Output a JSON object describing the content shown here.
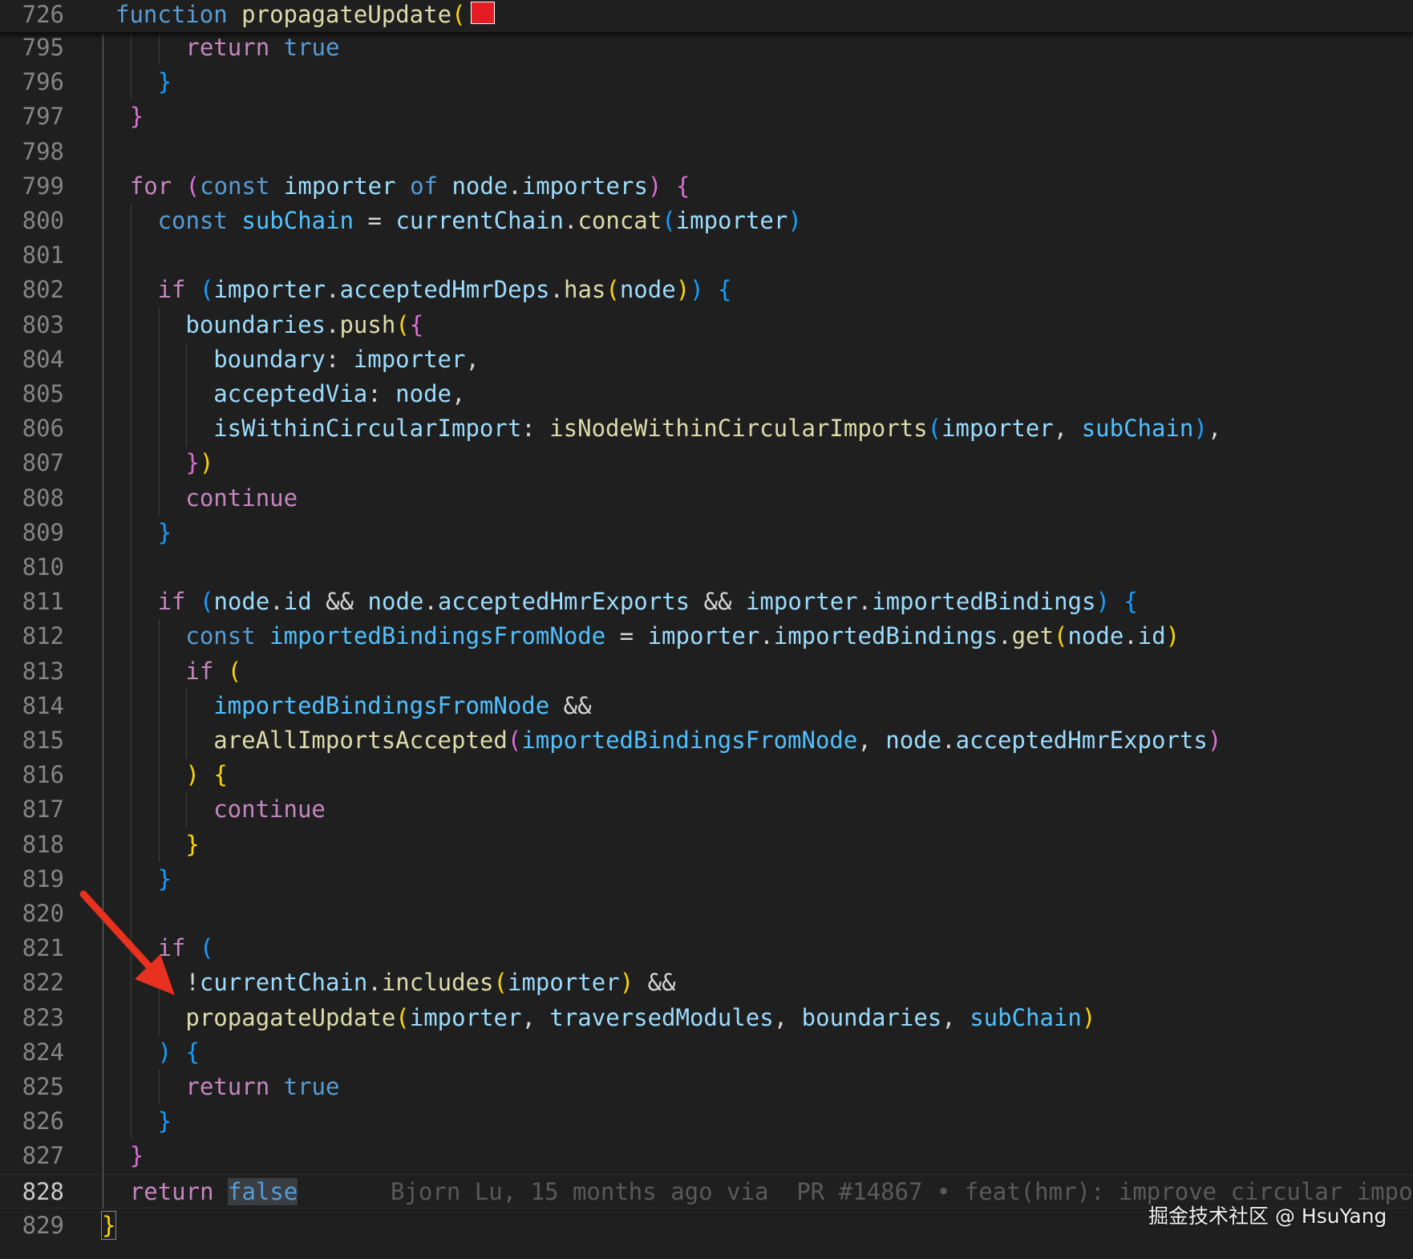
{
  "sticky_scroll": {
    "line_number": "726",
    "segments": [
      {
        "t": "function",
        "c": "kw"
      },
      {
        "t": " ",
        "c": "plain"
      },
      {
        "t": "propagateUpdate",
        "c": "fn"
      },
      {
        "t": "(",
        "c": "b1"
      }
    ]
  },
  "lines": [
    {
      "n": "795",
      "i": 3,
      "segs": [
        {
          "t": "return",
          "c": "ctl"
        },
        {
          "t": " ",
          "c": "plain"
        },
        {
          "t": "true",
          "c": "kw"
        }
      ]
    },
    {
      "n": "796",
      "i": 2,
      "segs": [
        {
          "t": "}",
          "c": "b3"
        }
      ]
    },
    {
      "n": "797",
      "i": 1,
      "segs": [
        {
          "t": "}",
          "c": "b2"
        }
      ]
    },
    {
      "n": "798",
      "i": 0,
      "segs": []
    },
    {
      "n": "799",
      "i": 1,
      "segs": [
        {
          "t": "for",
          "c": "ctl"
        },
        {
          "t": " ",
          "c": "plain"
        },
        {
          "t": "(",
          "c": "b2"
        },
        {
          "t": "const",
          "c": "kw"
        },
        {
          "t": " ",
          "c": "plain"
        },
        {
          "t": "importer",
          "c": "var"
        },
        {
          "t": " ",
          "c": "plain"
        },
        {
          "t": "of",
          "c": "kw"
        },
        {
          "t": " ",
          "c": "plain"
        },
        {
          "t": "node",
          "c": "var"
        },
        {
          "t": ".",
          "c": "plain"
        },
        {
          "t": "importers",
          "c": "var"
        },
        {
          "t": ")",
          "c": "b2"
        },
        {
          "t": " ",
          "c": "plain"
        },
        {
          "t": "{",
          "c": "b2"
        }
      ]
    },
    {
      "n": "800",
      "i": 2,
      "segs": [
        {
          "t": "const",
          "c": "kw"
        },
        {
          "t": " ",
          "c": "plain"
        },
        {
          "t": "subChain",
          "c": "cst"
        },
        {
          "t": " = ",
          "c": "plain"
        },
        {
          "t": "currentChain",
          "c": "var"
        },
        {
          "t": ".",
          "c": "plain"
        },
        {
          "t": "concat",
          "c": "fn"
        },
        {
          "t": "(",
          "c": "b3"
        },
        {
          "t": "importer",
          "c": "var"
        },
        {
          "t": ")",
          "c": "b3"
        }
      ]
    },
    {
      "n": "801",
      "i": 0,
      "segs": []
    },
    {
      "n": "802",
      "i": 2,
      "segs": [
        {
          "t": "if",
          "c": "ctl"
        },
        {
          "t": " ",
          "c": "plain"
        },
        {
          "t": "(",
          "c": "b3"
        },
        {
          "t": "importer",
          "c": "var"
        },
        {
          "t": ".",
          "c": "plain"
        },
        {
          "t": "acceptedHmrDeps",
          "c": "var"
        },
        {
          "t": ".",
          "c": "plain"
        },
        {
          "t": "has",
          "c": "fn"
        },
        {
          "t": "(",
          "c": "b1"
        },
        {
          "t": "node",
          "c": "var"
        },
        {
          "t": ")",
          "c": "b1"
        },
        {
          "t": ")",
          "c": "b3"
        },
        {
          "t": " ",
          "c": "plain"
        },
        {
          "t": "{",
          "c": "b3"
        }
      ]
    },
    {
      "n": "803",
      "i": 3,
      "segs": [
        {
          "t": "boundaries",
          "c": "var"
        },
        {
          "t": ".",
          "c": "plain"
        },
        {
          "t": "push",
          "c": "fn"
        },
        {
          "t": "(",
          "c": "b1"
        },
        {
          "t": "{",
          "c": "b2"
        }
      ]
    },
    {
      "n": "804",
      "i": 4,
      "segs": [
        {
          "t": "boundary",
          "c": "var"
        },
        {
          "t": ": ",
          "c": "plain"
        },
        {
          "t": "importer",
          "c": "var"
        },
        {
          "t": ",",
          "c": "plain"
        }
      ]
    },
    {
      "n": "805",
      "i": 4,
      "segs": [
        {
          "t": "acceptedVia",
          "c": "var"
        },
        {
          "t": ": ",
          "c": "plain"
        },
        {
          "t": "node",
          "c": "var"
        },
        {
          "t": ",",
          "c": "plain"
        }
      ]
    },
    {
      "n": "806",
      "i": 4,
      "segs": [
        {
          "t": "isWithinCircularImport",
          "c": "var"
        },
        {
          "t": ": ",
          "c": "plain"
        },
        {
          "t": "isNodeWithinCircularImports",
          "c": "fn"
        },
        {
          "t": "(",
          "c": "b3"
        },
        {
          "t": "importer",
          "c": "var"
        },
        {
          "t": ", ",
          "c": "plain"
        },
        {
          "t": "subChain",
          "c": "cst"
        },
        {
          "t": ")",
          "c": "b3"
        },
        {
          "t": ",",
          "c": "plain"
        }
      ]
    },
    {
      "n": "807",
      "i": 3,
      "segs": [
        {
          "t": "}",
          "c": "b2"
        },
        {
          "t": ")",
          "c": "b1"
        }
      ]
    },
    {
      "n": "808",
      "i": 3,
      "segs": [
        {
          "t": "continue",
          "c": "ctl"
        }
      ]
    },
    {
      "n": "809",
      "i": 2,
      "segs": [
        {
          "t": "}",
          "c": "b3"
        }
      ]
    },
    {
      "n": "810",
      "i": 0,
      "segs": []
    },
    {
      "n": "811",
      "i": 2,
      "segs": [
        {
          "t": "if",
          "c": "ctl"
        },
        {
          "t": " ",
          "c": "plain"
        },
        {
          "t": "(",
          "c": "b3"
        },
        {
          "t": "node",
          "c": "var"
        },
        {
          "t": ".",
          "c": "plain"
        },
        {
          "t": "id",
          "c": "var"
        },
        {
          "t": " && ",
          "c": "plain"
        },
        {
          "t": "node",
          "c": "var"
        },
        {
          "t": ".",
          "c": "plain"
        },
        {
          "t": "acceptedHmrExports",
          "c": "var"
        },
        {
          "t": " && ",
          "c": "plain"
        },
        {
          "t": "importer",
          "c": "var"
        },
        {
          "t": ".",
          "c": "plain"
        },
        {
          "t": "importedBindings",
          "c": "var"
        },
        {
          "t": ")",
          "c": "b3"
        },
        {
          "t": " ",
          "c": "plain"
        },
        {
          "t": "{",
          "c": "b3"
        }
      ]
    },
    {
      "n": "812",
      "i": 3,
      "segs": [
        {
          "t": "const",
          "c": "kw"
        },
        {
          "t": " ",
          "c": "plain"
        },
        {
          "t": "importedBindingsFromNode",
          "c": "cst"
        },
        {
          "t": " = ",
          "c": "plain"
        },
        {
          "t": "importer",
          "c": "var"
        },
        {
          "t": ".",
          "c": "plain"
        },
        {
          "t": "importedBindings",
          "c": "var"
        },
        {
          "t": ".",
          "c": "plain"
        },
        {
          "t": "get",
          "c": "fn"
        },
        {
          "t": "(",
          "c": "b1"
        },
        {
          "t": "node",
          "c": "var"
        },
        {
          "t": ".",
          "c": "plain"
        },
        {
          "t": "id",
          "c": "var"
        },
        {
          "t": ")",
          "c": "b1"
        }
      ]
    },
    {
      "n": "813",
      "i": 3,
      "segs": [
        {
          "t": "if",
          "c": "ctl"
        },
        {
          "t": " ",
          "c": "plain"
        },
        {
          "t": "(",
          "c": "b1"
        }
      ]
    },
    {
      "n": "814",
      "i": 4,
      "segs": [
        {
          "t": "importedBindingsFromNode",
          "c": "cst"
        },
        {
          "t": " &&",
          "c": "plain"
        }
      ]
    },
    {
      "n": "815",
      "i": 4,
      "segs": [
        {
          "t": "areAllImportsAccepted",
          "c": "fn"
        },
        {
          "t": "(",
          "c": "b2"
        },
        {
          "t": "importedBindingsFromNode",
          "c": "cst"
        },
        {
          "t": ", ",
          "c": "plain"
        },
        {
          "t": "node",
          "c": "var"
        },
        {
          "t": ".",
          "c": "plain"
        },
        {
          "t": "acceptedHmrExports",
          "c": "var"
        },
        {
          "t": ")",
          "c": "b2"
        }
      ]
    },
    {
      "n": "816",
      "i": 3,
      "segs": [
        {
          "t": ")",
          "c": "b1"
        },
        {
          "t": " ",
          "c": "plain"
        },
        {
          "t": "{",
          "c": "b1"
        }
      ]
    },
    {
      "n": "817",
      "i": 4,
      "segs": [
        {
          "t": "continue",
          "c": "ctl"
        }
      ]
    },
    {
      "n": "818",
      "i": 3,
      "segs": [
        {
          "t": "}",
          "c": "b1"
        }
      ]
    },
    {
      "n": "819",
      "i": 2,
      "segs": [
        {
          "t": "}",
          "c": "b3"
        }
      ]
    },
    {
      "n": "820",
      "i": 0,
      "segs": []
    },
    {
      "n": "821",
      "i": 2,
      "segs": [
        {
          "t": "if",
          "c": "ctl"
        },
        {
          "t": " ",
          "c": "plain"
        },
        {
          "t": "(",
          "c": "b3"
        }
      ]
    },
    {
      "n": "822",
      "i": 3,
      "segs": [
        {
          "t": "!",
          "c": "plain"
        },
        {
          "t": "currentChain",
          "c": "var"
        },
        {
          "t": ".",
          "c": "plain"
        },
        {
          "t": "includes",
          "c": "fn"
        },
        {
          "t": "(",
          "c": "b1"
        },
        {
          "t": "importer",
          "c": "var"
        },
        {
          "t": ")",
          "c": "b1"
        },
        {
          "t": " &&",
          "c": "plain"
        }
      ]
    },
    {
      "n": "823",
      "i": 3,
      "segs": [
        {
          "t": "propagateUpdate",
          "c": "fn"
        },
        {
          "t": "(",
          "c": "b1"
        },
        {
          "t": "importer",
          "c": "var"
        },
        {
          "t": ", ",
          "c": "plain"
        },
        {
          "t": "traversedModules",
          "c": "var"
        },
        {
          "t": ", ",
          "c": "plain"
        },
        {
          "t": "boundaries",
          "c": "var"
        },
        {
          "t": ", ",
          "c": "plain"
        },
        {
          "t": "subChain",
          "c": "cst"
        },
        {
          "t": ")",
          "c": "b1"
        }
      ]
    },
    {
      "n": "824",
      "i": 2,
      "segs": [
        {
          "t": ")",
          "c": "b3"
        },
        {
          "t": " ",
          "c": "plain"
        },
        {
          "t": "{",
          "c": "b3"
        }
      ]
    },
    {
      "n": "825",
      "i": 3,
      "segs": [
        {
          "t": "return",
          "c": "ctl"
        },
        {
          "t": " ",
          "c": "plain"
        },
        {
          "t": "true",
          "c": "kw"
        }
      ]
    },
    {
      "n": "826",
      "i": 2,
      "segs": [
        {
          "t": "}",
          "c": "b3"
        }
      ]
    },
    {
      "n": "827",
      "i": 1,
      "segs": [
        {
          "t": "}",
          "c": "b2"
        }
      ]
    },
    {
      "n": "828",
      "i": 1,
      "current": true,
      "segs": [
        {
          "t": "return",
          "c": "ctl"
        },
        {
          "t": " ",
          "c": "plain"
        },
        {
          "t": "false",
          "c": "kw",
          "hl": true
        }
      ],
      "blame": "Bjorn Lu, 15 months ago via  PR #14867 • feat(hmr): improve circular impor"
    },
    {
      "n": "829",
      "i": 0,
      "segs": [
        {
          "t": "}",
          "c": "b1",
          "cursor": true
        }
      ]
    }
  ],
  "watermark": "掘金技术社区 @ HsuYang",
  "colors": {
    "background": "#1f1f1f",
    "keyword": "#569cd6",
    "control": "#c586c0",
    "function": "#dcdcaa",
    "variable": "#9cdcfe",
    "constant": "#4fc1ff",
    "bracket_1": "#ffd700",
    "bracket_2": "#da70d6",
    "bracket_3": "#179fff",
    "annotation_arrow": "#e8311f"
  }
}
